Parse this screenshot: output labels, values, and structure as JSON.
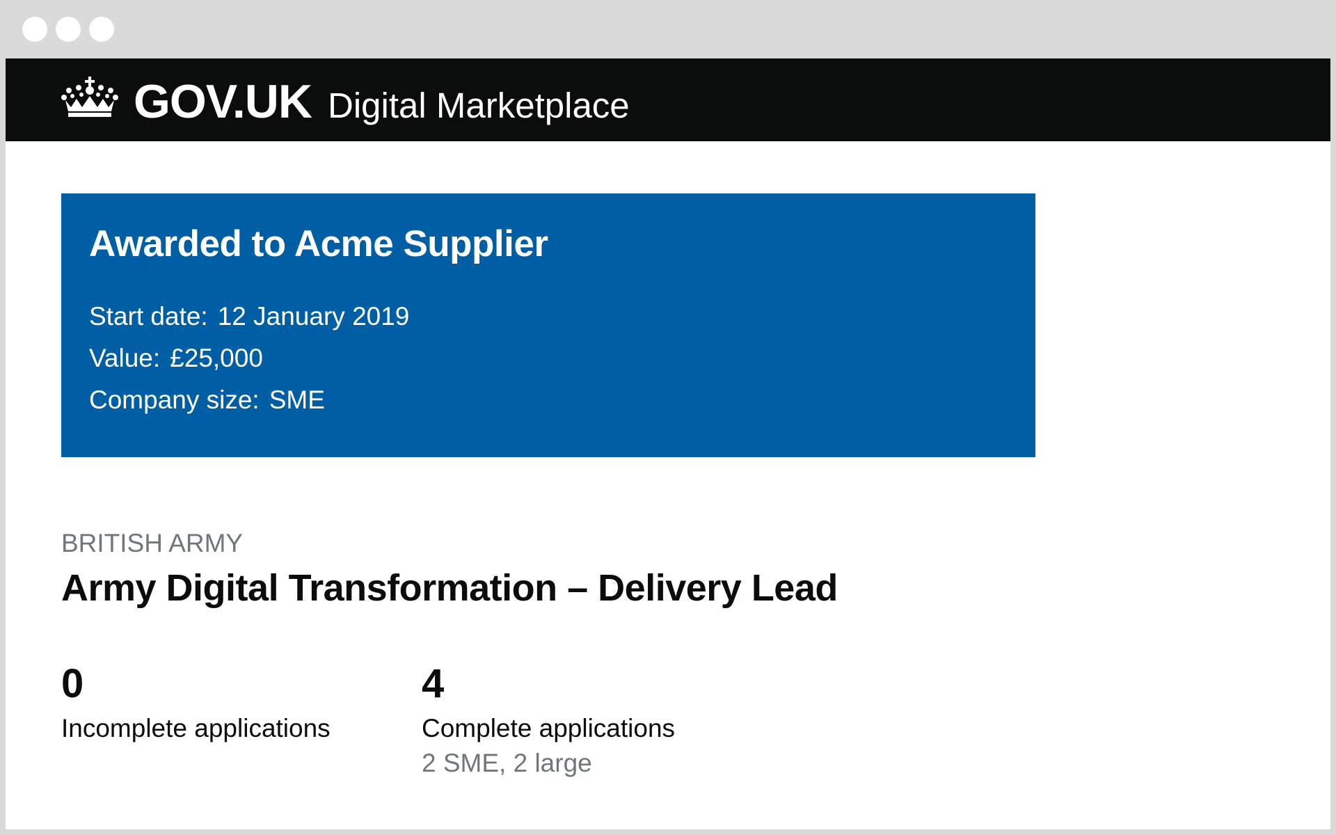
{
  "header": {
    "wordmark": "GOV.UK",
    "service_name": "Digital Marketplace",
    "logo_icon": "crown-icon"
  },
  "award": {
    "title": "Awarded to Acme Supplier",
    "start_date_label": "Start date:",
    "start_date_value": "12 January 2019",
    "value_label": "Value:",
    "value_value": "£25,000",
    "company_size_label": "Company size:",
    "company_size_value": "SME",
    "panel_color": "#005ea5"
  },
  "opportunity": {
    "organisation": "BRITISH ARMY",
    "title": "Army Digital Transformation – Delivery Lead"
  },
  "stats": {
    "incomplete": {
      "number": "0",
      "label": "Incomplete applications"
    },
    "complete": {
      "number": "4",
      "label": "Complete applications",
      "breakdown": "2 SME, 2 large"
    }
  },
  "colors": {
    "header_background": "#0b0c0c",
    "secondary_text": "#6f777b",
    "window_chrome": "#dadada"
  }
}
